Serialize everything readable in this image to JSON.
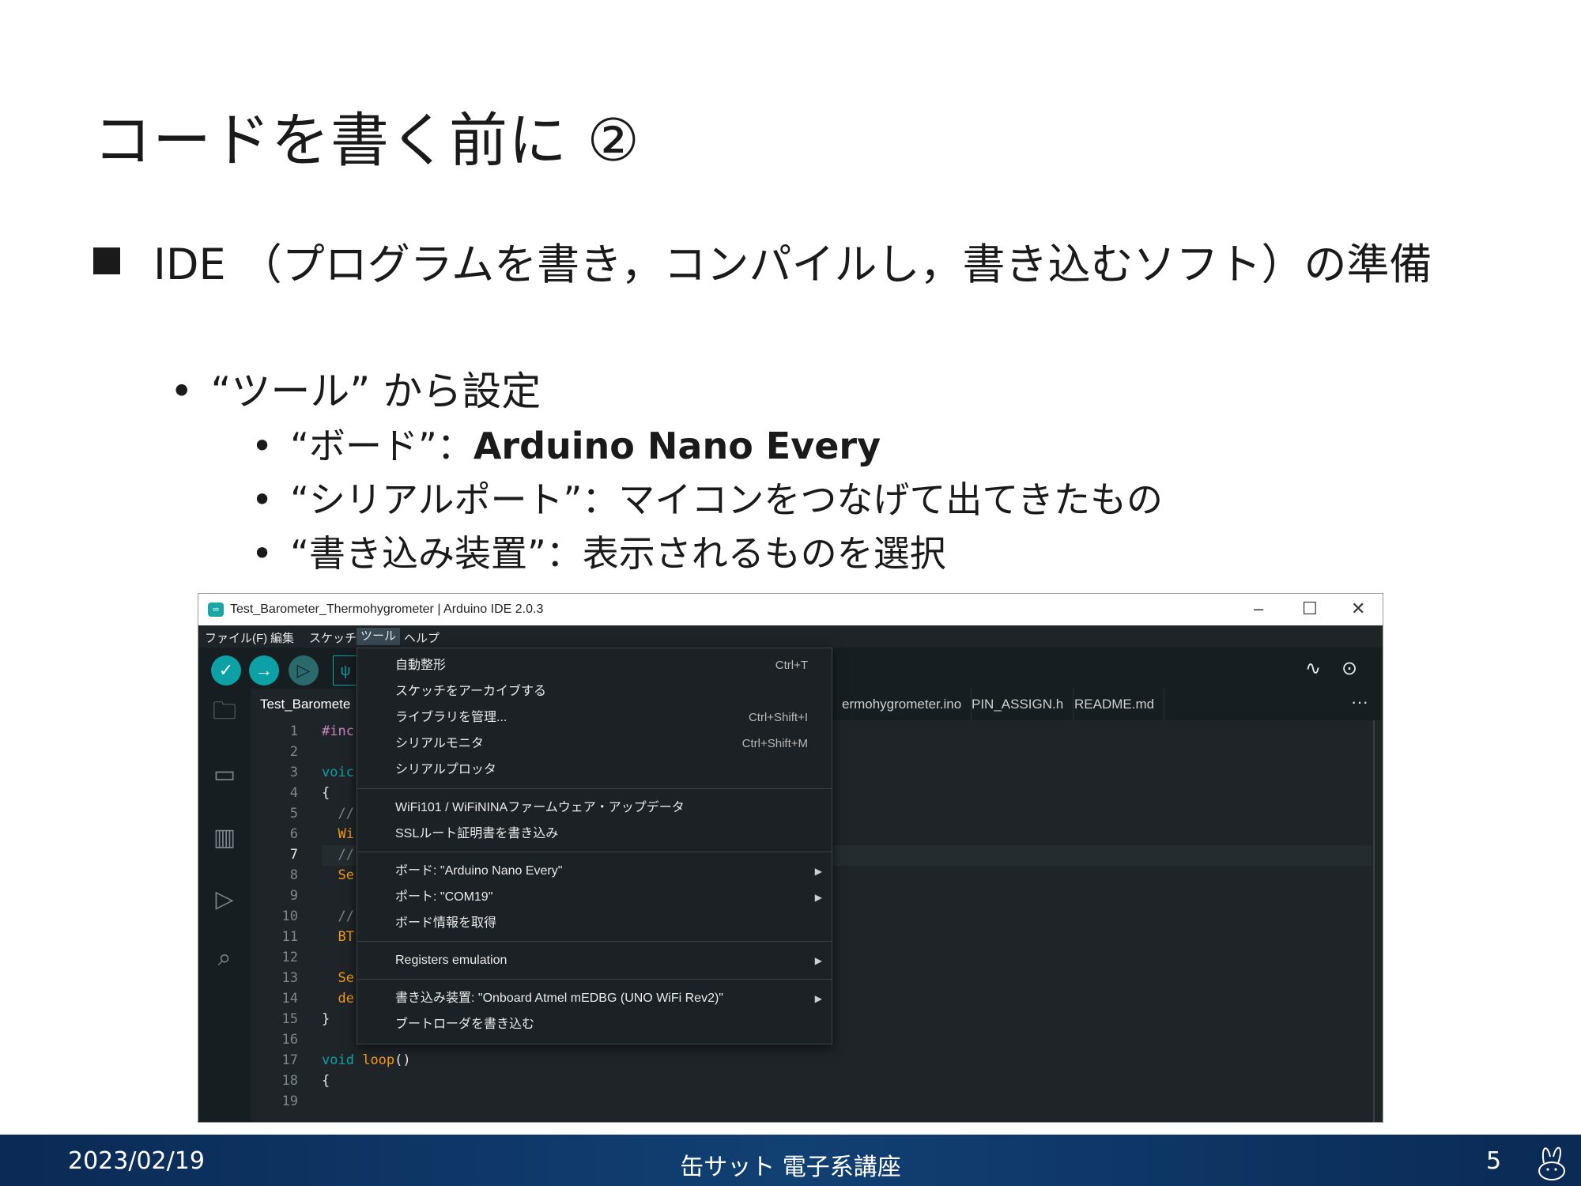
{
  "slide": {
    "title": "コードを書く前に ②",
    "bullet1": "IDE （プログラムを書き，コンパイルし，書き込むソフト）の準備",
    "bullet2": "“ツール” から設定",
    "sub": [
      {
        "label": "“ボード”：",
        "value": "Arduino Nano Every"
      },
      {
        "label": "“シリアルポート”：マイコンをつなげて出てきたもの",
        "value": ""
      },
      {
        "label": "“書き込み装置”：表示されるものを選択",
        "value": ""
      }
    ]
  },
  "ide": {
    "window_title": "Test_Barometer_Thermohygrometer | Arduino IDE 2.0.3",
    "menu": [
      "ファイル(F)",
      "編集",
      "スケッチ",
      "ツール",
      "ヘルプ"
    ],
    "active_menu": "ツール",
    "tabs": [
      "Test_Baromete",
      "ermohygrometer.ino",
      "PIN_ASSIGN.h",
      "README.md"
    ],
    "line_numbers": [
      "1",
      "2",
      "3",
      "4",
      "5",
      "6",
      "7",
      "8",
      "9",
      "10",
      "11",
      "12",
      "13",
      "14",
      "15",
      "16",
      "17",
      "18",
      "19"
    ],
    "current_line": "7",
    "code": {
      "l1": "#inc",
      "l3": "voic",
      "l4": "{",
      "l5": "  //",
      "l6": "  Wi",
      "l7": "  //",
      "l8": "  Se",
      "l10": "  //",
      "l11": "  BT",
      "l13": "  Se",
      "l14": "  de",
      "l15": "}",
      "l17_kw": "void",
      "l17_fn": "loop",
      "l17_p": "()",
      "l18": "{"
    },
    "dropdown": [
      {
        "label": "自動整形",
        "shortcut": "Ctrl+T"
      },
      {
        "label": "スケッチをアーカイブする",
        "shortcut": ""
      },
      {
        "label": "ライブラリを管理...",
        "shortcut": "Ctrl+Shift+I"
      },
      {
        "label": "シリアルモニタ",
        "shortcut": "Ctrl+Shift+M"
      },
      {
        "label": "シリアルプロッタ",
        "shortcut": ""
      },
      {
        "label": "WiFi101 /  WiFiNINAファームウェア・アップデータ",
        "shortcut": ""
      },
      {
        "label": "SSLルート証明書を書き込み",
        "shortcut": ""
      },
      {
        "label": "ボード: \"Arduino Nano Every\"",
        "shortcut": ""
      },
      {
        "label": "ポート: \"COM19\"",
        "shortcut": ""
      },
      {
        "label": "ボード情報を取得",
        "shortcut": ""
      },
      {
        "label": "Registers emulation",
        "shortcut": ""
      },
      {
        "label": "書き込み装置: \"Onboard Atmel mEDBG (UNO WiFi Rev2)\"",
        "shortcut": ""
      },
      {
        "label": "ブートローダを書き込む",
        "shortcut": ""
      }
    ]
  },
  "footer": {
    "date": "2023/02/19",
    "center": "缶サット 電子系講座",
    "page": "5"
  },
  "colors": {
    "accent": "#0ca1a6",
    "footer_bg": "#114073",
    "ide_bg": "#1f2428",
    "code_keyword": "#0ca1a6",
    "code_function": "#f39c12"
  }
}
